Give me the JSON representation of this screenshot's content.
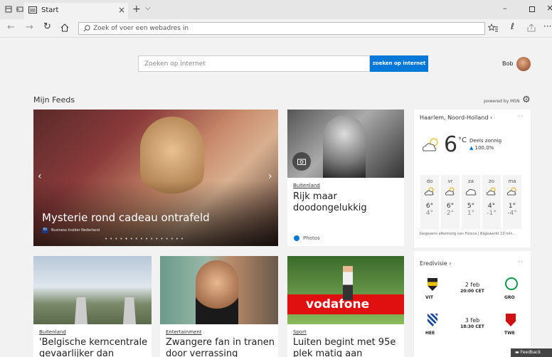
{
  "browser": {
    "tab_title": "Start",
    "address_placeholder": "Zoek of voer een webadres in"
  },
  "search": {
    "placeholder": "Zoeken op internet",
    "button": "zoeken op internet"
  },
  "user": {
    "name": "Bob"
  },
  "feeds": {
    "title": "Mijn Feeds",
    "powered": "powered by MSN"
  },
  "hero": {
    "headline": "Mysterie rond cadeau ontrafeld",
    "source": "Business Insider Nederland",
    "source_badge": "BI"
  },
  "side_article": {
    "tag": "Buitenland",
    "headline": "Rijk maar doodongelukkig",
    "footer": "Photos"
  },
  "weather": {
    "location": "Haarlem, Noord-Holland",
    "temp": "6",
    "unit": "°C",
    "condition": "Deels zonnig",
    "precip": "100,0%",
    "days": [
      {
        "d": "do",
        "hi": "6°",
        "lo": "4°"
      },
      {
        "d": "vr",
        "hi": "6°",
        "lo": "2°"
      },
      {
        "d": "za",
        "hi": "5°",
        "lo": "1°"
      },
      {
        "d": "zo",
        "hi": "4°",
        "lo": "-1°"
      },
      {
        "d": "ma",
        "hi": "1°",
        "lo": "-4°"
      }
    ],
    "credit": "Gegevens afkomstig van Foreca | Bijgewerkt 10 min..."
  },
  "league": {
    "title": "Eredivisie",
    "matches": [
      {
        "home": "VIT",
        "away": "GRO",
        "date": "2 feb",
        "time": "20:00 CET"
      },
      {
        "home": "HEE",
        "away": "TWE",
        "date": "3 feb",
        "time": "18:30 CET"
      }
    ]
  },
  "articles": [
    {
      "tag": "Buitenland",
      "headline": "'Belgische kerncentrale gevaarlijker dan gedacht'"
    },
    {
      "tag": "Entertainment",
      "headline": "Zwangere fan in tranen door verrassing"
    },
    {
      "tag": "Sport",
      "headline": "Luiten begint met 95e plek matig aan toernooi"
    }
  ],
  "sponsor_text": "vodafone",
  "feedback": "Feedback",
  "colors": {
    "accent": "#0078d7"
  }
}
